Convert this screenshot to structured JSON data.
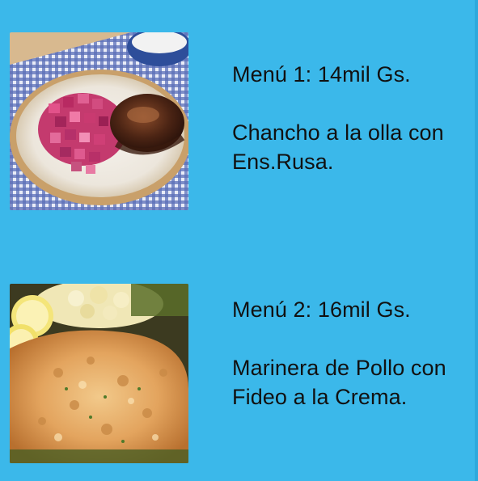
{
  "menus": [
    {
      "price_label": "Menú 1: 14mil Gs.",
      "dish": "Chancho a la olla con Ens.Rusa.",
      "photo_icon": "pork-with-beet-salad-photo"
    },
    {
      "price_label": "Menú 2: 16mil Gs.",
      "dish": "Marinera de Pollo con Fideo a la Crema.",
      "photo_icon": "breaded-chicken-photo"
    }
  ],
  "colors": {
    "background": "#3bb8ea",
    "text": "#111111"
  }
}
